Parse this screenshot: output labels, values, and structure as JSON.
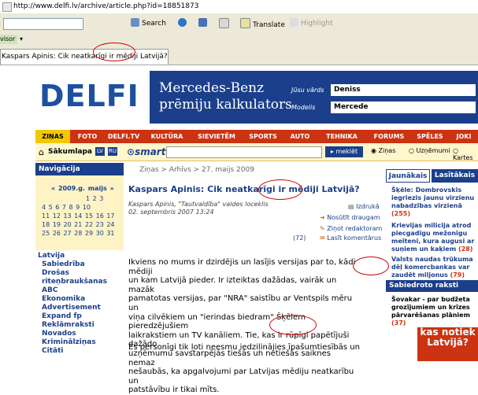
{
  "browser": {
    "url": "http://www.delfi.lv/archive/article.php?id=18851873",
    "toolbar": {
      "search_label": "Search",
      "translate_label": "Translate",
      "highlight_label": "Highlight",
      "advisor_label": "visor"
    },
    "tab_title": "Kaspars Apinis: Cik neatkarīgi ir mēdiji Latvijā?"
  },
  "site": {
    "logo": "DELFI",
    "banner": {
      "line1": "Mercedes-Benz",
      "line2": "prēmiju kalkulators",
      "name_label": "Jūsu vārds",
      "name_value": "Deniss",
      "model_label": "Modelis",
      "model_value": "Mercede"
    },
    "nav": [
      "ZIŅAS",
      "FOTO",
      "DELFI.TV",
      "KULTŪRA",
      "SIEVIETĒM",
      "SPORTS",
      "AUTO",
      "TEHNIKA",
      "FORUMS",
      "SPĒLES",
      "JOKI"
    ],
    "subbar": {
      "home_label": "Sākumlapa",
      "lang_lv": "LV",
      "lang_ru": "RU",
      "smart_label": "smart",
      "search_button": "meklēt",
      "radio_news": "Ziņas",
      "radio_discounts": "Uzņēmumi",
      "radio_maps": "Kartes"
    },
    "left": {
      "nav_header": "Navigācija",
      "calendar_title": "« 2009.g. maijs »",
      "calendar_rows": [
        "1  2  3",
        "4  5  6  7  8  9 10",
        "11 12 13 14 15 16 17",
        "18 19 20 21 22 23 24",
        "25 26 27 28 29 30 31"
      ],
      "section": "Latvija",
      "links": [
        "Sabiedrība",
        "Drošas",
        "riteņbraukšanas",
        "ABC",
        "Ekonomika",
        "Advertisement",
        "Expand fp",
        "Reklāmraksti",
        "Novados",
        "Kriminālziņas",
        "Citāti"
      ]
    },
    "article": {
      "breadcrumb": "Ziņas > Arhīvs > 27. maijs 2009",
      "title": "Kaspars Apinis: Cik neatkarīgi ir mēdiji Latvijā?",
      "author_line1": "Kaspars Apinis, \"Tautvaldība\" valdes loceklis",
      "author_line2": "02. septembris 2007 13:24",
      "side_print": "Izdrukā",
      "side_send": "Nosūtīt draugam",
      "side_report": "Ziņot redaktoram",
      "side_comments": "Lasīt komentārus",
      "comments_count": "(72)",
      "body_lines": [
        "Ikviens no mums ir dzirdējis un lasījis versijas par to, kādi mēdiji",
        "un kam Latvijā pieder. Ir izteiktas dažādas, vairāk un mazāk",
        "pamatotas versijas, par \"NRA\" saistību ar Ventspils mēru un",
        "viņa cilvēkiem un \"ierindas biedram\" Šķēlem pieredzējušiem",
        "laikrakstiem un TV kanāliem. Tie, kas ir rūpīgi papētījuši dažādo",
        "uzņēmumu savstarpējās tiešās un netiešās saiknes nemaz",
        "nešaubās, ka apgalvojumi par Latvijas mēdiju neatkarību un",
        "patstāvību ir tikai mīts."
      ],
      "second_paragraph": "Es personīgi tik ļoti neesmu iedziļinājies īpašumtiesībās un"
    },
    "right": {
      "tab_newest": "Jaunākais",
      "tab_read": "Lasītākais",
      "items": [
        {
          "text": "Šķēle: Dombrovskis iegriezis jaunu virzienu nabadzības virzienā",
          "count": "(255)"
        },
        {
          "text": "Krievijas milicija atrod piecgadīgu mežonīgu meiteni, kura augusi ar suņiem un kaķiem",
          "count": "(28)"
        },
        {
          "text": "Valsts naudas trūkuma dēļ komercbankas var zaudēt miljonus",
          "count": "(79)"
        }
      ],
      "cooperation_header": "Sabiedroto raksti",
      "coop_item": {
        "text": "Šovakar - par budžeta grozījumiem un krīzes pārvarēšanas plāniem",
        "count": "(37)"
      },
      "promo": "kas notiek Latvijā?"
    },
    "colors": {
      "brand_blue": "#1b3f8a",
      "nav_red": "#cc3311",
      "nav_active": "#f2c800",
      "annotation_red": "#cc0000"
    }
  }
}
